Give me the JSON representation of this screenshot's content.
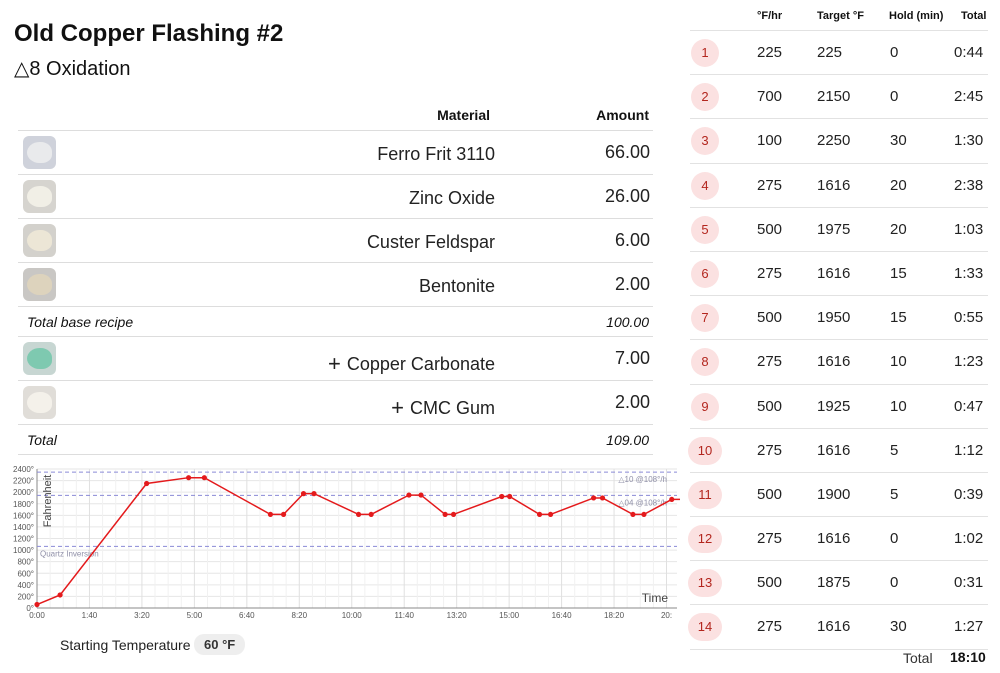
{
  "recipe": {
    "title": "Old Copper Flashing #2",
    "subtitle": "△8 Oxidation",
    "header": {
      "material": "Material",
      "amount": "Amount"
    },
    "base_materials": [
      {
        "name": "Ferro Frit 3110",
        "amount": "66.00",
        "color": "#e9eaec",
        "bg": "#cfd2db"
      },
      {
        "name": "Zinc Oxide",
        "amount": "26.00",
        "color": "#f1efe6",
        "bg": "#d6d4cf"
      },
      {
        "name": "Custer Feldspar",
        "amount": "6.00",
        "color": "#ece6d6",
        "bg": "#d3d1cc"
      },
      {
        "name": "Bentonite",
        "amount": "2.00",
        "color": "#ddd3bd",
        "bg": "#c9c7c4"
      }
    ],
    "base_total": {
      "label": "Total base recipe",
      "value": "100.00"
    },
    "additions": [
      {
        "prefix": "+",
        "name": "Copper Carbonate",
        "amount": "7.00",
        "color": "#7ec9b0",
        "bg": "#c7d6d2"
      },
      {
        "prefix": "+",
        "name": "CMC Gum",
        "amount": "2.00",
        "color": "#f4f1ea",
        "bg": "#e0ddd8"
      }
    ],
    "grand_total": {
      "label": "Total",
      "value": "109.00"
    }
  },
  "chart_data": {
    "type": "line",
    "ylabel": "Fahrenheit",
    "xlabel": "Time",
    "ylim": [
      0,
      2400
    ],
    "xlim_minutes": [
      0,
      1220
    ],
    "y_ticks": [
      "0°",
      "200°",
      "400°",
      "600°",
      "800°",
      "1000°",
      "1200°",
      "1400°",
      "1600°",
      "1800°",
      "2000°",
      "2200°",
      "2400°"
    ],
    "x_ticks": [
      "0:00",
      "1:40",
      "3:20",
      "5:00",
      "6:40",
      "8:20",
      "10:00",
      "11:40",
      "13:20",
      "15:00",
      "16:40",
      "18:20",
      "20:"
    ],
    "series": [
      {
        "color": "#e41a1c",
        "x_minutes": [
          0,
          44,
          209,
          289,
          319,
          445,
          470,
          508,
          528,
          613,
          637,
          709,
          732,
          778,
          794,
          886,
          901,
          958,
          979,
          1061,
          1078,
          1136,
          1157,
          1210,
          1237
        ],
        "y": [
          60,
          225,
          2150,
          2250,
          2250,
          1616,
          1616,
          1975,
          1975,
          1616,
          1616,
          1950,
          1950,
          1616,
          1616,
          1925,
          1925,
          1616,
          1616,
          1900,
          1900,
          1616,
          1616,
          1875,
          1875
        ]
      }
    ],
    "reference_lines": [
      {
        "value": 2345,
        "label": "△10 @108°/h"
      },
      {
        "value": 1945,
        "label": "△04 @108°/h"
      },
      {
        "value": 1063,
        "label": "Quartz Inversion"
      }
    ]
  },
  "start": {
    "label": "Starting Temperature",
    "value": "60 °F"
  },
  "firing": {
    "headers": {
      "rate": "°F/hr",
      "target": "Target °F",
      "hold": "Hold (min)",
      "total": "Total"
    },
    "steps": [
      {
        "n": "1",
        "rate": "225",
        "target": "225",
        "hold": "0",
        "total": "0:44"
      },
      {
        "n": "2",
        "rate": "700",
        "target": "2150",
        "hold": "0",
        "total": "2:45"
      },
      {
        "n": "3",
        "rate": "100",
        "target": "2250",
        "hold": "30",
        "total": "1:30"
      },
      {
        "n": "4",
        "rate": "275",
        "target": "1616",
        "hold": "20",
        "total": "2:38"
      },
      {
        "n": "5",
        "rate": "500",
        "target": "1975",
        "hold": "20",
        "total": "1:03"
      },
      {
        "n": "6",
        "rate": "275",
        "target": "1616",
        "hold": "15",
        "total": "1:33"
      },
      {
        "n": "7",
        "rate": "500",
        "target": "1950",
        "hold": "15",
        "total": "0:55"
      },
      {
        "n": "8",
        "rate": "275",
        "target": "1616",
        "hold": "10",
        "total": "1:23"
      },
      {
        "n": "9",
        "rate": "500",
        "target": "1925",
        "hold": "10",
        "total": "0:47"
      },
      {
        "n": "10",
        "rate": "275",
        "target": "1616",
        "hold": "5",
        "total": "1:12"
      },
      {
        "n": "11",
        "rate": "500",
        "target": "1900",
        "hold": "5",
        "total": "0:39"
      },
      {
        "n": "12",
        "rate": "275",
        "target": "1616",
        "hold": "0",
        "total": "1:02"
      },
      {
        "n": "13",
        "rate": "500",
        "target": "1875",
        "hold": "0",
        "total": "0:31"
      },
      {
        "n": "14",
        "rate": "275",
        "target": "1616",
        "hold": "30",
        "total": "1:27"
      }
    ],
    "total_label": "Total",
    "total_value": "18:10"
  }
}
